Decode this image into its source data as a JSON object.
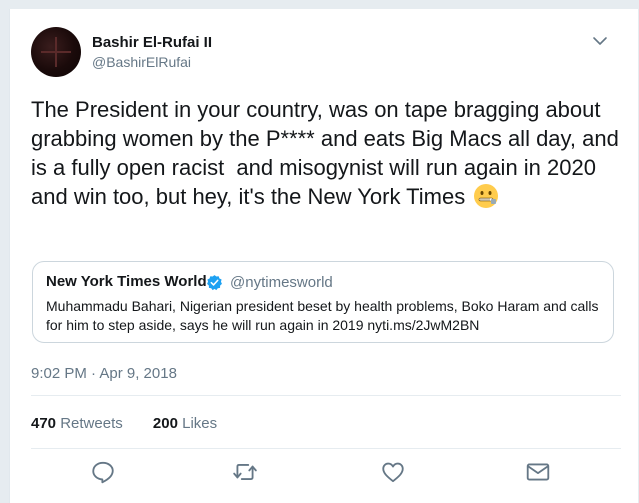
{
  "tweet": {
    "author_name": "Bashir El-Rufai II",
    "author_handle": "@BashirElRufai",
    "text": "The President in your country, was on tape bragging about grabbing women by the P**** and eats Big Macs all day, and is a fully open racist  and misogynist will run again in 2020 and win too, but hey, it's the New York Times ",
    "emoji": "zipper-mouth-face-emoji",
    "timestamp": "9:02 PM · Apr 9, 2018",
    "retweets_count": "470",
    "retweets_label": "Retweets",
    "likes_count": "200",
    "likes_label": "Likes"
  },
  "quoted_tweet": {
    "author_name": "New York Times World",
    "author_handle": "@nytimesworld",
    "text": "Muhammadu Bahari, Nigerian president beset by health problems, Boko Haram and calls for him to step aside, says he will run again in 2019 nyti.ms/2JwM2BN",
    "verified": true
  },
  "icons": [
    "chevron-down-icon",
    "verified-badge-icon",
    "reply-icon",
    "retweet-icon",
    "like-icon",
    "direct-message-icon"
  ],
  "colors": {
    "background": "#e6ecf0",
    "card": "#ffffff",
    "text_primary": "#14171a",
    "text_secondary": "#657786",
    "verified_blue": "#1da1f2",
    "border": "#ccd6dd"
  }
}
